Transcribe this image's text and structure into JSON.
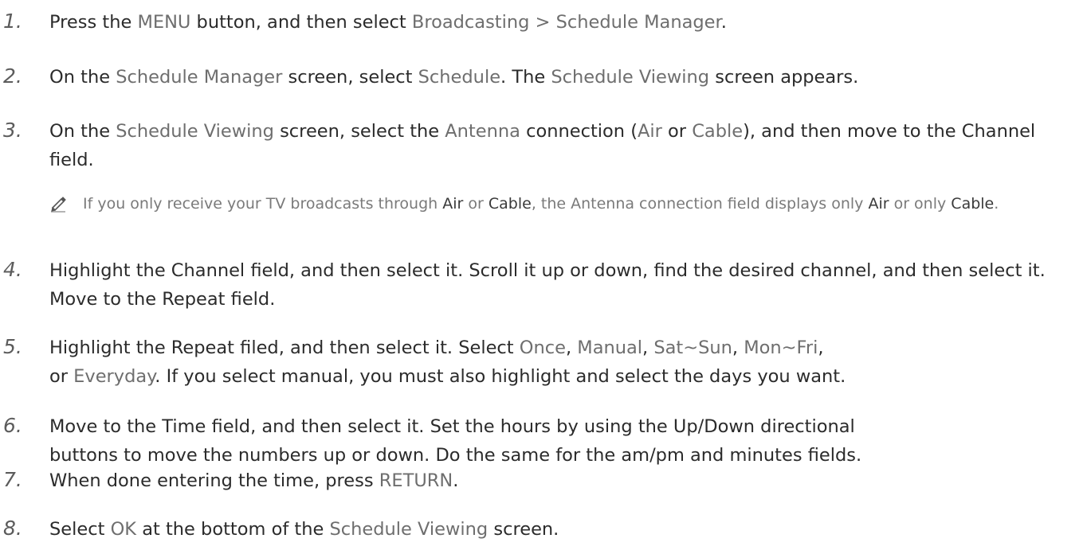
{
  "steps": [
    {
      "number": "1.",
      "segments": [
        {
          "t": "Press the ",
          "hl": false
        },
        {
          "t": "MENU",
          "hl": true
        },
        {
          "t": " button, and then select ",
          "hl": false
        },
        {
          "t": "Broadcasting > Schedule Manager",
          "hl": true
        },
        {
          "t": ".",
          "hl": false
        }
      ]
    },
    {
      "number": "2.",
      "segments": [
        {
          "t": "On the ",
          "hl": false
        },
        {
          "t": "Schedule Manager",
          "hl": true
        },
        {
          "t": " screen, select ",
          "hl": false
        },
        {
          "t": "Schedule",
          "hl": true
        },
        {
          "t": ". The ",
          "hl": false
        },
        {
          "t": "Schedule Viewing",
          "hl": true
        },
        {
          "t": " screen appears.",
          "hl": false
        }
      ]
    },
    {
      "number": "3.",
      "segments": [
        {
          "t": "On the ",
          "hl": false
        },
        {
          "t": "Schedule Viewing",
          "hl": true
        },
        {
          "t": " screen, select the ",
          "hl": false
        },
        {
          "t": "Antenna",
          "hl": true
        },
        {
          "t": " connection (",
          "hl": false
        },
        {
          "t": "Air",
          "hl": true
        },
        {
          "t": " or ",
          "hl": false
        },
        {
          "t": "Cable",
          "hl": true
        },
        {
          "t": "), and then move to the Channel field.",
          "hl": false
        }
      ]
    },
    {
      "number": "4.",
      "segments": [
        {
          "t": "Highlight the Channel field, and then select it. Scroll it up or down, find the desired channel, and then select it. Move to the Repeat field.",
          "hl": false
        }
      ]
    },
    {
      "number": "5.",
      "segments": [
        {
          "t": "Highlight the Repeat filed, and then select it. Select ",
          "hl": false
        },
        {
          "t": "Once",
          "hl": true
        },
        {
          "t": ", ",
          "hl": false
        },
        {
          "t": "Manual",
          "hl": true
        },
        {
          "t": ", ",
          "hl": false
        },
        {
          "t": "Sat~Sun",
          "hl": true
        },
        {
          "t": ", ",
          "hl": false
        },
        {
          "t": "Mon~Fri",
          "hl": true
        },
        {
          "t": ", or ",
          "hl": false
        },
        {
          "t": "Everyday",
          "hl": true
        },
        {
          "t": ". If you select manual, you must also highlight and select the days you want.",
          "hl": false
        }
      ]
    },
    {
      "number": "6.",
      "segments": [
        {
          "t": "Move to the Time field, and then select it. Set the hours by using the Up/Down directional buttons to move the numbers up or down. Do the same for the am/pm and minutes fields.",
          "hl": false
        }
      ]
    },
    {
      "number": "7.",
      "segments": [
        {
          "t": "When done entering the time, press ",
          "hl": false
        },
        {
          "t": "RETURN",
          "hl": true
        },
        {
          "t": ".",
          "hl": false
        }
      ]
    },
    {
      "number": "8.",
      "segments": [
        {
          "t": "Select ",
          "hl": false
        },
        {
          "t": "OK",
          "hl": true
        },
        {
          "t": " at the bottom of the ",
          "hl": false
        },
        {
          "t": "Schedule Viewing",
          "hl": true
        },
        {
          "t": " screen.",
          "hl": false
        }
      ]
    }
  ],
  "note": {
    "icon": "pencil-icon",
    "segments": [
      {
        "t": "If you only receive your TV broadcasts through ",
        "b": false
      },
      {
        "t": "Air",
        "b": true
      },
      {
        "t": " or ",
        "b": false
      },
      {
        "t": "Cable",
        "b": true
      },
      {
        "t": ", the Antenna connection field displays only ",
        "b": false
      },
      {
        "t": "Air",
        "b": true
      },
      {
        "t": " or only ",
        "b": false
      },
      {
        "t": "Cable",
        "b": true
      },
      {
        "t": ".",
        "b": false
      }
    ]
  },
  "colors": {
    "body_text": "#2b2b2b",
    "highlight_text": "#6e6e6e",
    "note_text": "#7a7a7a"
  }
}
